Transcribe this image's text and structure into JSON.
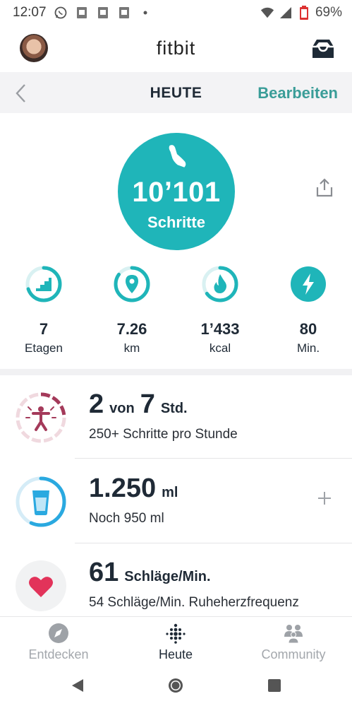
{
  "status_bar": {
    "time": "12:07",
    "battery": "69%",
    "icons": [
      "whatsapp-icon",
      "sim-card-icon",
      "sim-card-icon",
      "sim-card-icon",
      "dot-icon",
      "wifi-icon",
      "signal-icon",
      "battery-icon"
    ]
  },
  "header": {
    "app_title": "fitbit",
    "icons": [
      "avatar",
      "inbox-icon"
    ]
  },
  "subheader": {
    "back_icon": "chevron-left-icon",
    "title": "HEUTE",
    "edit_label": "Bearbeiten"
  },
  "hero": {
    "steps_value": "10’101",
    "steps_label": "Schritte",
    "steps_icon": "shoe-icon",
    "share_icon": "share-icon",
    "accent_color": "#1fb5b9"
  },
  "stats": [
    {
      "icon": "stairs-icon",
      "value": "7",
      "unit": "Etagen",
      "progress": 0.7
    },
    {
      "icon": "location-pin-icon",
      "value": "7.26",
      "unit": "km",
      "progress": 0.85
    },
    {
      "icon": "flame-icon",
      "value": "1’433",
      "unit": "kcal",
      "progress": 0.65
    },
    {
      "icon": "lightning-icon",
      "value": "80",
      "unit": "Min.",
      "progress": 1.0
    }
  ],
  "tiles": {
    "hourly": {
      "icon": "hourly-activity-icon",
      "value": "2",
      "connector": "von",
      "goal": "7",
      "unit": "Std.",
      "subtitle": "250+ Schritte pro Stunde",
      "progress": 0.2857,
      "color": "#a43a5a"
    },
    "water": {
      "icon": "water-glass-icon",
      "value": "1.250",
      "unit": "ml",
      "subtitle": "Noch 950 ml",
      "add_icon": "plus-icon",
      "progress": 0.568,
      "color": "#2aa9e0"
    },
    "heart": {
      "icon": "heart-icon",
      "value": "61",
      "unit": "Schläge/Min.",
      "subtitle": "54 Schläge/Min. Ruheherzfrequenz",
      "color": "#e2335a"
    }
  },
  "bottom_nav": [
    {
      "icon": "compass-icon",
      "label": "Entdecken",
      "active": false
    },
    {
      "icon": "fitbit-dots-icon",
      "label": "Heute",
      "active": true
    },
    {
      "icon": "community-icon",
      "label": "Community",
      "active": false
    }
  ],
  "system_nav": [
    "back-triangle-icon",
    "home-circle-icon",
    "recents-square-icon"
  ]
}
